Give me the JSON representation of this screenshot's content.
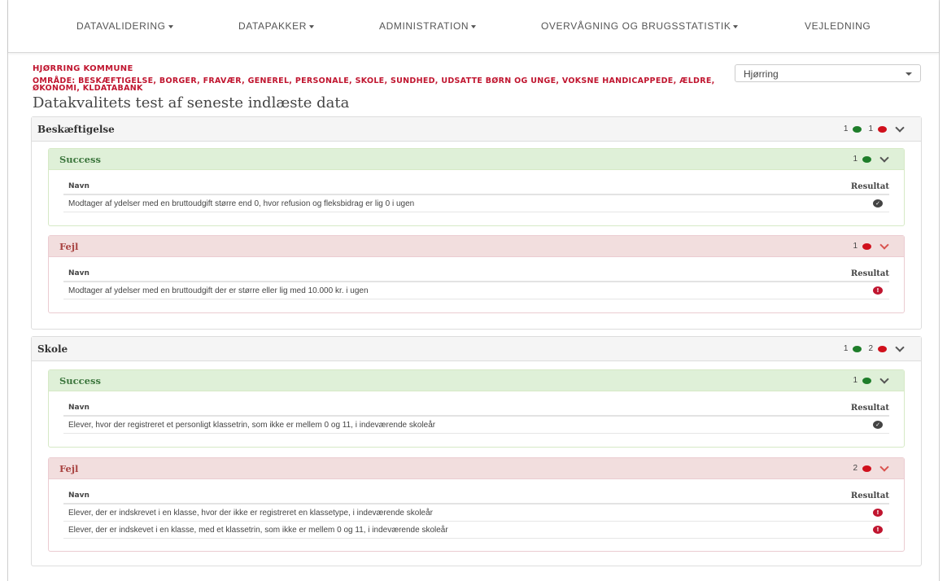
{
  "nav": {
    "items": [
      {
        "label": "DATAVALIDERING",
        "dropdown": true
      },
      {
        "label": "DATAPAKKER",
        "dropdown": true
      },
      {
        "label": "ADMINISTRATION",
        "dropdown": true
      },
      {
        "label": "OVERVÅGNING OG BRUGSSTATISTIK",
        "dropdown": true
      },
      {
        "label": "VEJLEDNING",
        "dropdown": false
      }
    ]
  },
  "header": {
    "org": "HJØRRING KOMMUNE",
    "area": "OMRÅDE: BESKÆFTIGELSE, BORGER, FRAVÆR, GENEREL, PERSONALE, SKOLE, SUNDHED, UDSATTE BØRN OG UNGE, VOKSNE HANDICAPPEDE, ÆLDRE, ØKONOMI, KLDATABANK",
    "municipality_select": "Hjørring",
    "title": "Datakvalitets test af seneste indlæste data"
  },
  "colors": {
    "accent": "#c0152f",
    "success": "#1e7d2a",
    "error": "#d0101c"
  },
  "panels": [
    {
      "title": "Beskæftigelse",
      "success_count": "1",
      "fail_count": "1",
      "success": {
        "title": "Success",
        "count": "1",
        "col_name": "Navn",
        "col_result": "Resultat",
        "rows": [
          {
            "name": "Modtager af ydelser med en bruttoudgift større end 0, hvor refusion og fleksbidrag er lig 0 i ugen",
            "icon": "check-circle-icon"
          }
        ]
      },
      "fail": {
        "title": "Fejl",
        "count": "1",
        "col_name": "Navn",
        "col_result": "Resultat",
        "rows": [
          {
            "name": "Modtager af ydelser med en bruttoudgift der er større eller lig med 10.000 kr. i ugen",
            "icon": "error-circle-icon"
          }
        ]
      }
    },
    {
      "title": "Skole",
      "success_count": "1",
      "fail_count": "2",
      "success": {
        "title": "Success",
        "count": "1",
        "col_name": "Navn",
        "col_result": "Resultat",
        "rows": [
          {
            "name": "Elever, hvor der registreret et personligt klassetrin, som ikke er mellem 0 og 11, i indeværende skoleår",
            "icon": "check-circle-icon"
          }
        ]
      },
      "fail": {
        "title": "Fejl",
        "count": "2",
        "col_name": "Navn",
        "col_result": "Resultat",
        "rows": [
          {
            "name": "Elever, der er indskrevet i en klasse, hvor der ikke er registreret en klassetype, i indeværende skoleår",
            "icon": "error-circle-icon"
          },
          {
            "name": "Elever, der er indskevet i en klasse, med et klassetrin, som ikke er mellem 0 og 11, i indeværende skoleår",
            "icon": "error-circle-icon"
          }
        ]
      }
    }
  ]
}
